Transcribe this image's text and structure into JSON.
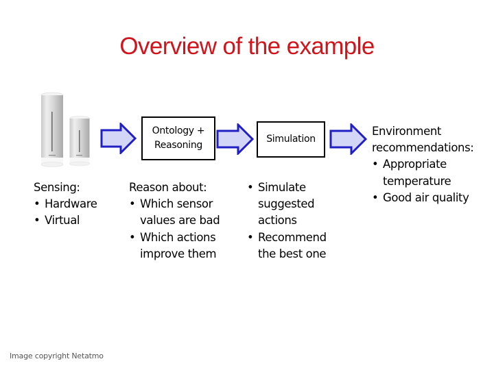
{
  "title": "Overview of the example",
  "device_image": {
    "description": "Netatmo weather station sensor cylinders",
    "icon": "sensor-device-icon"
  },
  "flow": {
    "arrow_color": "#1f1fc4",
    "arrow_fill": "#d4d6f7",
    "boxes": [
      {
        "label_line1": "Ontology +",
        "label_line2": "Reasoning"
      },
      {
        "label": "Simulation"
      }
    ]
  },
  "sensing": {
    "heading": "Sensing:",
    "items": [
      "Hardware",
      "Virtual"
    ]
  },
  "reason": {
    "heading": "Reason about:",
    "items": [
      "Which sensor values are bad",
      "Which actions improve them"
    ]
  },
  "simulate": {
    "items": [
      "Simulate suggested actions",
      "Recommend the best one"
    ]
  },
  "recommendations": {
    "heading_line1": "Environment",
    "heading_line2": "recommendations:",
    "items": [
      "Appropriate temperature",
      "Good air quality"
    ]
  },
  "copyright": "Image copyright Netatmo",
  "colors": {
    "title": "#d0141b"
  }
}
